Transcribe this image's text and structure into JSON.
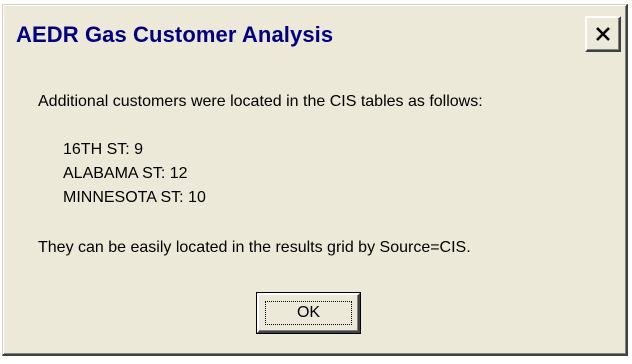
{
  "window": {
    "title": "AEDR Gas Customer Analysis",
    "close_icon": "close-icon"
  },
  "message": {
    "intro": "Additional customers were located in the CIS tables as follows:",
    "customers": [
      "16TH ST: 9",
      "ALABAMA ST: 12",
      "MINNESOTA ST: 10"
    ],
    "footer": "They can be easily located in the results grid by Source=CIS."
  },
  "buttons": {
    "ok_label": "OK"
  },
  "colors": {
    "title_text": "#000080",
    "dialog_background": "#ece9d8"
  }
}
